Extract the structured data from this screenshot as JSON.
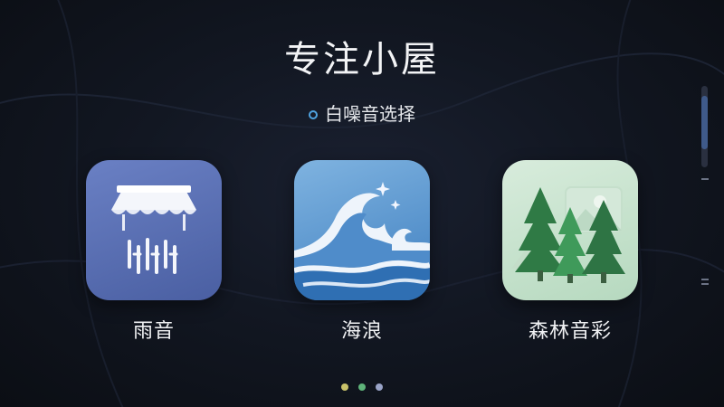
{
  "header": {
    "title": "专注小屋",
    "subtitle": "白噪音选择"
  },
  "sounds": [
    {
      "label": "雨音",
      "icon": "rain-house-icon"
    },
    {
      "label": "海浪",
      "icon": "ocean-wave-icon"
    },
    {
      "label": "森林音彩",
      "icon": "forest-trees-icon"
    }
  ],
  "pager": {
    "count": 3,
    "colors": [
      "#c9c26a",
      "#5fb37a",
      "#9aa4c8"
    ]
  },
  "scroll": {
    "position": 0.35,
    "visible_fraction": 0.65
  },
  "colors": {
    "background": "#121722",
    "accent": "#4fa3e0"
  }
}
